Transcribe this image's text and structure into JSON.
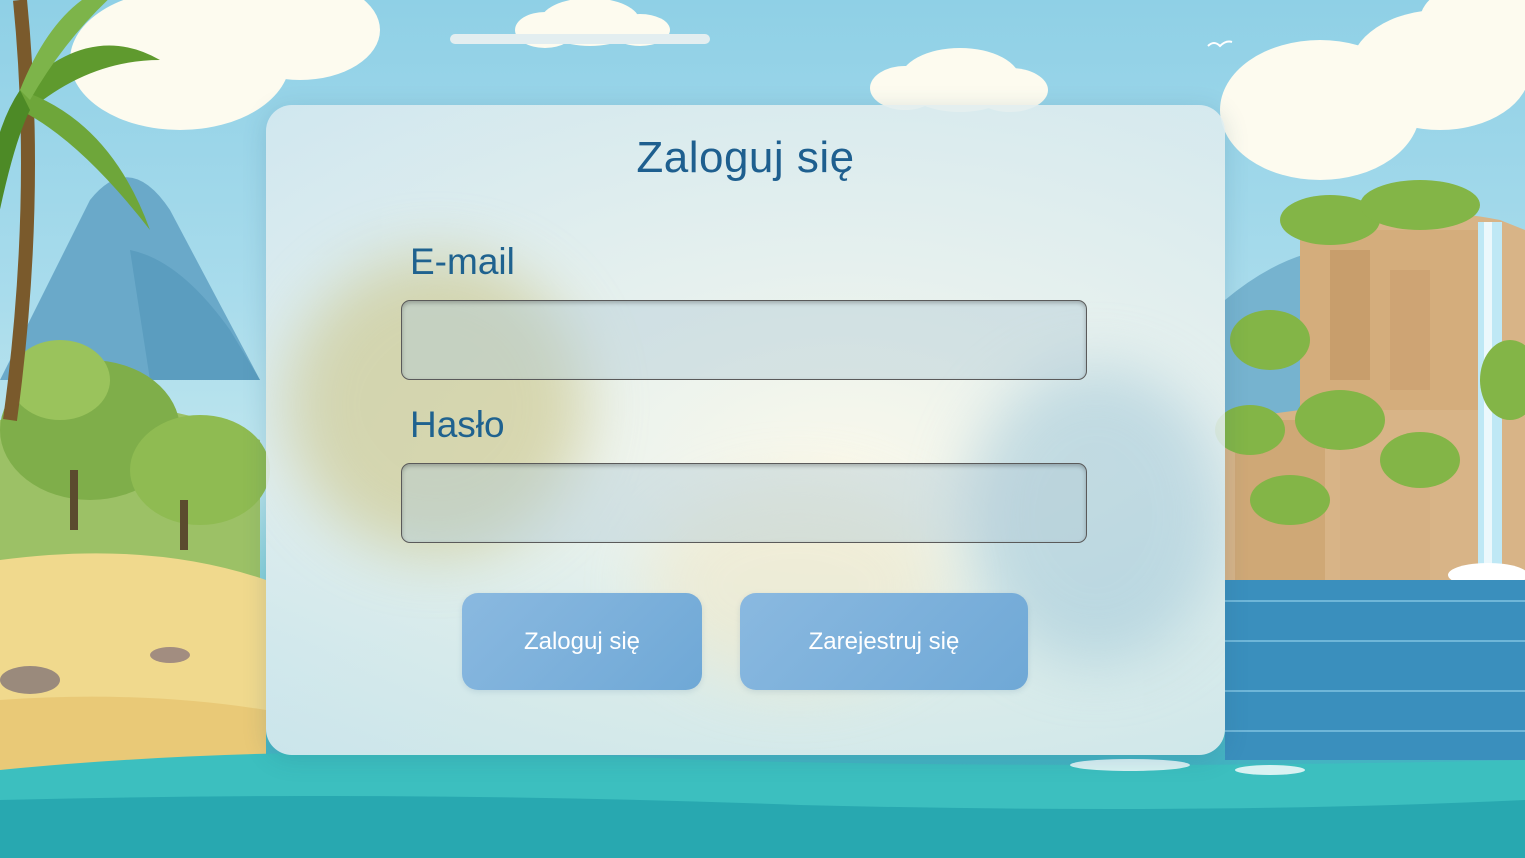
{
  "login": {
    "title": "Zaloguj się",
    "email_label": "E-mail",
    "email_value": "",
    "password_label": "Hasło",
    "password_value": "",
    "login_button": "Zaloguj się",
    "register_button": "Zarejestruj się"
  },
  "colors": {
    "title_text": "#1e5f8f",
    "button_bg": "#78afd9",
    "button_text": "#ffffff"
  },
  "icons": [
    "palm-tree-icon",
    "waterfall-icon",
    "seagull-icon",
    "cloud-icon"
  ]
}
